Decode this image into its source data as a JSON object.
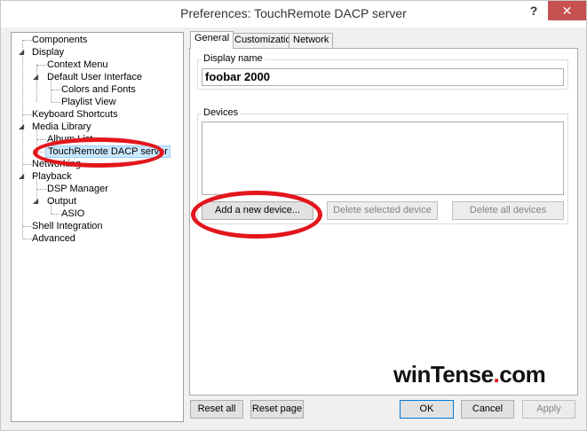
{
  "window": {
    "title": "Preferences: TouchRemote DACP server",
    "help_label": "?",
    "close_label": "✕"
  },
  "tree": {
    "items": [
      {
        "label": "Components"
      },
      {
        "label": "Display"
      },
      {
        "label": "Context Menu"
      },
      {
        "label": "Default User Interface"
      },
      {
        "label": "Colors and Fonts"
      },
      {
        "label": "Playlist View"
      },
      {
        "label": "Keyboard Shortcuts"
      },
      {
        "label": "Media Library"
      },
      {
        "label": "Album List"
      },
      {
        "label": "TouchRemote DACP server"
      },
      {
        "label": "Networking"
      },
      {
        "label": "Playback"
      },
      {
        "label": "DSP Manager"
      },
      {
        "label": "Output"
      },
      {
        "label": "ASIO"
      },
      {
        "label": "Shell Integration"
      },
      {
        "label": "Advanced"
      }
    ],
    "expanded_arrow": "◢"
  },
  "tabs": [
    {
      "label": "General"
    },
    {
      "label": "Customization"
    },
    {
      "label": "Network"
    }
  ],
  "general": {
    "display_name_label": "Display name",
    "display_name_value": "foobar 2000",
    "devices_label": "Devices",
    "add_device_label": "Add a new device...",
    "delete_selected_label": "Delete selected device",
    "delete_all_label": "Delete all devices"
  },
  "footer": {
    "reset_all_label": "Reset all",
    "reset_page_label": "Reset page",
    "ok_label": "OK",
    "cancel_label": "Cancel",
    "apply_label": "Apply"
  },
  "watermark": {
    "prefix": "winTense",
    "dot": ".",
    "suffix": "com"
  },
  "colors": {
    "annotation": "#e3161d",
    "close_button": "#c75050",
    "selection": "#cce8ff"
  }
}
